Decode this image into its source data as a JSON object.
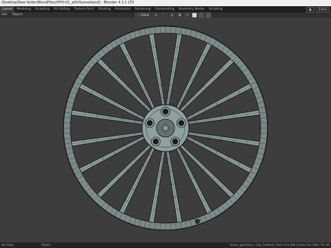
{
  "title": "/Desktop/New folder/BlendFiles/VFHI-01_withSceneblend] - Blender 4.2.1 LTS",
  "workspaces": [
    "Layout",
    "Modeling",
    "Sculpting",
    "UV Editing",
    "Texture Paint",
    "Shading",
    "Animation",
    "Rendering",
    "Compositing",
    "Geometry Nodes",
    "Scripting"
  ],
  "active_workspace": "Layout",
  "scene_label": "Scene",
  "toolbar": {
    "mode_menu": "ode",
    "object_menu": "Object",
    "orientation": "Global"
  },
  "status": {
    "left": "ate View",
    "object": "Object",
    "right": "Scene_geometry | Cap_Content | Verts 2x1,288 | Faces 2x1,040 | Tris 4K"
  },
  "colors": {
    "background": "#3d3d3d",
    "wireframe": "#0c0c0c",
    "surface": "#8fa09f"
  }
}
